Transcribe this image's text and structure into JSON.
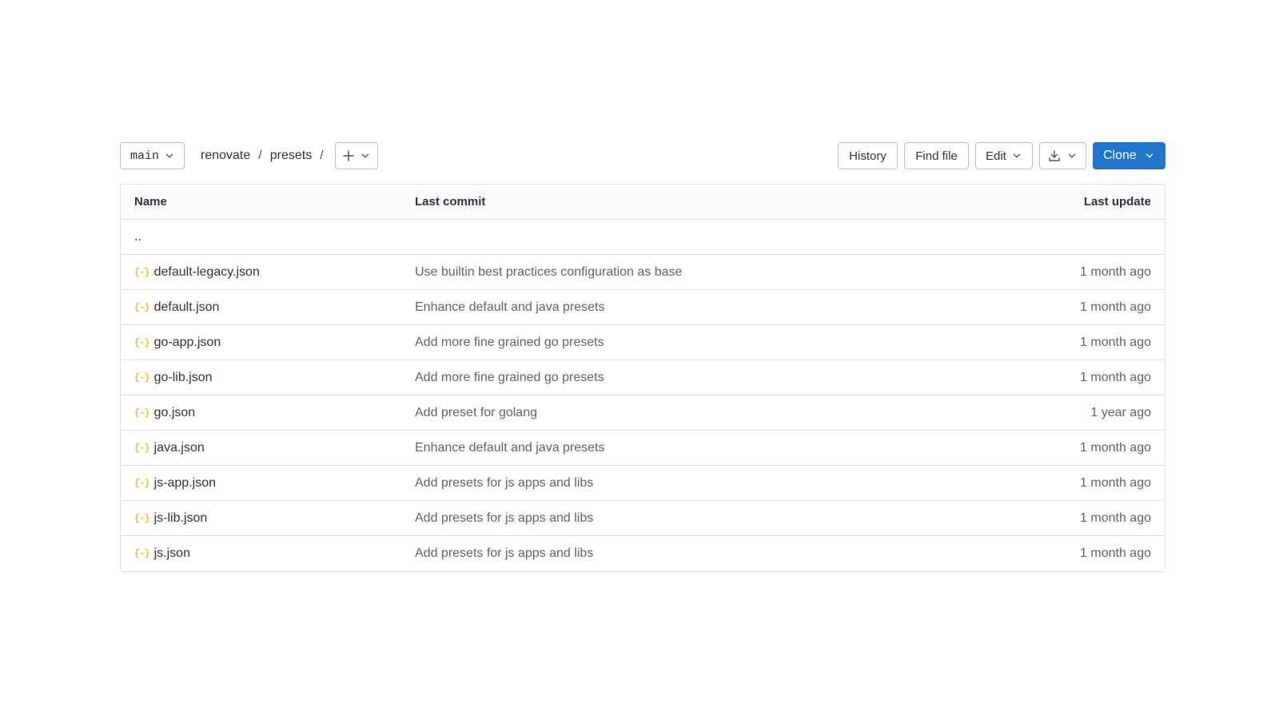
{
  "toolbar": {
    "branch": "main",
    "breadcrumb": [
      "renovate",
      "presets"
    ],
    "separator": "/",
    "history_label": "History",
    "find_file_label": "Find file",
    "edit_label": "Edit",
    "clone_label": "Clone"
  },
  "table": {
    "headers": {
      "name": "Name",
      "last_commit": "Last commit",
      "last_update": "Last update"
    },
    "parent_row": "..",
    "file_icon_glyph": "{-}",
    "rows": [
      {
        "name": "default-legacy.json",
        "commit": "Use builtin best practices configuration as base",
        "updated": "1 month ago"
      },
      {
        "name": "default.json",
        "commit": "Enhance default and java presets",
        "updated": "1 month ago"
      },
      {
        "name": "go-app.json",
        "commit": "Add more fine grained go presets",
        "updated": "1 month ago"
      },
      {
        "name": "go-lib.json",
        "commit": "Add more fine grained go presets",
        "updated": "1 month ago"
      },
      {
        "name": "go.json",
        "commit": "Add preset for golang",
        "updated": "1 year ago"
      },
      {
        "name": "java.json",
        "commit": "Enhance default and java presets",
        "updated": "1 month ago"
      },
      {
        "name": "js-app.json",
        "commit": "Add presets for js apps and libs",
        "updated": "1 month ago"
      },
      {
        "name": "js-lib.json",
        "commit": "Add presets for js apps and libs",
        "updated": "1 month ago"
      },
      {
        "name": "js.json",
        "commit": "Add presets for js apps and libs",
        "updated": "1 month ago"
      }
    ]
  },
  "colors": {
    "accent": "#1f75cb",
    "json_icon": "#e9be3a",
    "border": "#dcdcde"
  },
  "icons": [
    "chevron-down-icon",
    "plus-icon",
    "download-icon",
    "json-file-icon"
  ]
}
